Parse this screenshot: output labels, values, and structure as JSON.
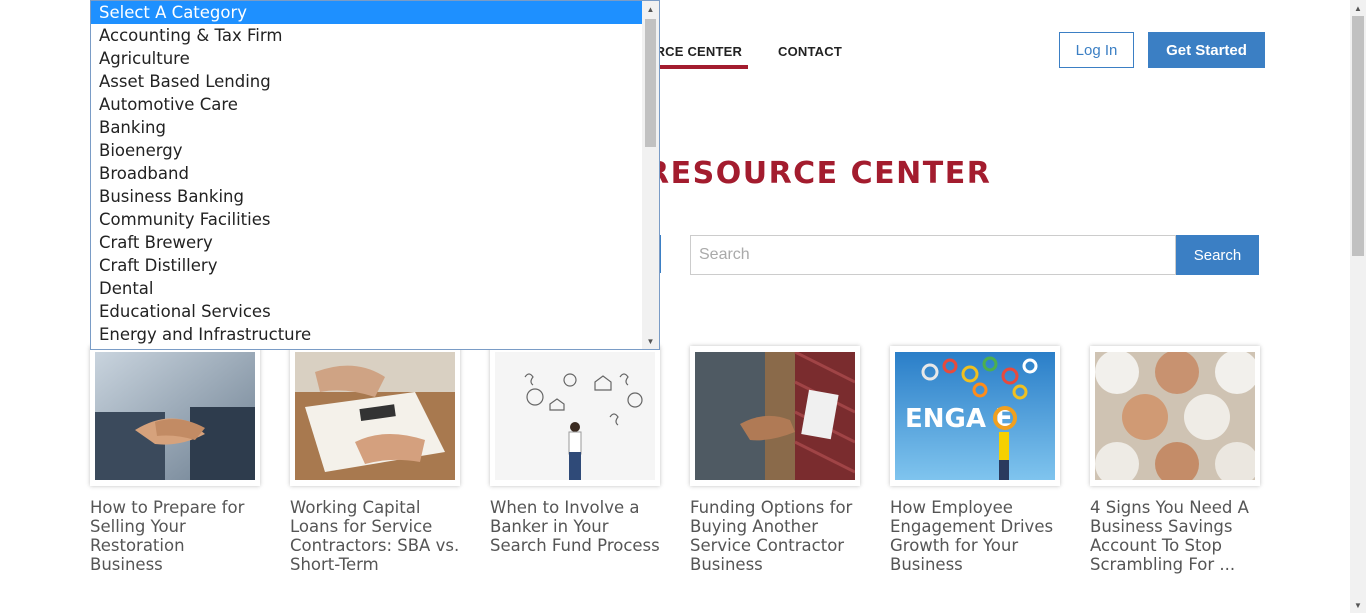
{
  "nav": {
    "items": [
      {
        "label": "URCE CENTER",
        "active": true
      },
      {
        "label": "CONTACT",
        "active": false
      }
    ],
    "login_label": "Log In",
    "get_started_label": "Get Started"
  },
  "page_title": "RESOURCE CENTER",
  "search": {
    "placeholder": "Search",
    "button_label": "Search"
  },
  "category_dropdown": {
    "options": [
      "Select A Category",
      "Accounting & Tax Firm",
      "Agriculture",
      "Asset Based Lending",
      "Automotive Care",
      "Banking",
      "Bioenergy",
      "Broadband",
      "Business Banking",
      "Community Facilities",
      "Craft Brewery",
      "Craft Distillery",
      "Dental",
      "Educational Services",
      "Energy and Infrastructure"
    ],
    "selected_index": 0
  },
  "articles": [
    {
      "title": "How to Prepare for Selling Your Restoration Business",
      "image": "handshake-photo"
    },
    {
      "title": "Working Capital Loans for Service Contractors: SBA vs. Short-Term",
      "image": "documents-calculator-photo"
    },
    {
      "title": "When to Involve a Banker in Your Search Fund Process",
      "image": "man-thinking-doodles"
    },
    {
      "title": "Funding Options for Buying Another Service Contractor Business",
      "image": "contractor-handshake-photo"
    },
    {
      "title": "How Employee Engagement Drives Growth for Your Business",
      "image": "engage-gears-illustration",
      "image_text": "ENGA  E"
    },
    {
      "title": "4 Signs You Need A Business Savings Account To Stop Scrambling For ...",
      "image": "eggs-carton-photo"
    }
  ],
  "colors": {
    "brand_red": "#a31c2e",
    "accent_blue": "#3b7fc4",
    "selected_blue": "#1e90ff"
  }
}
